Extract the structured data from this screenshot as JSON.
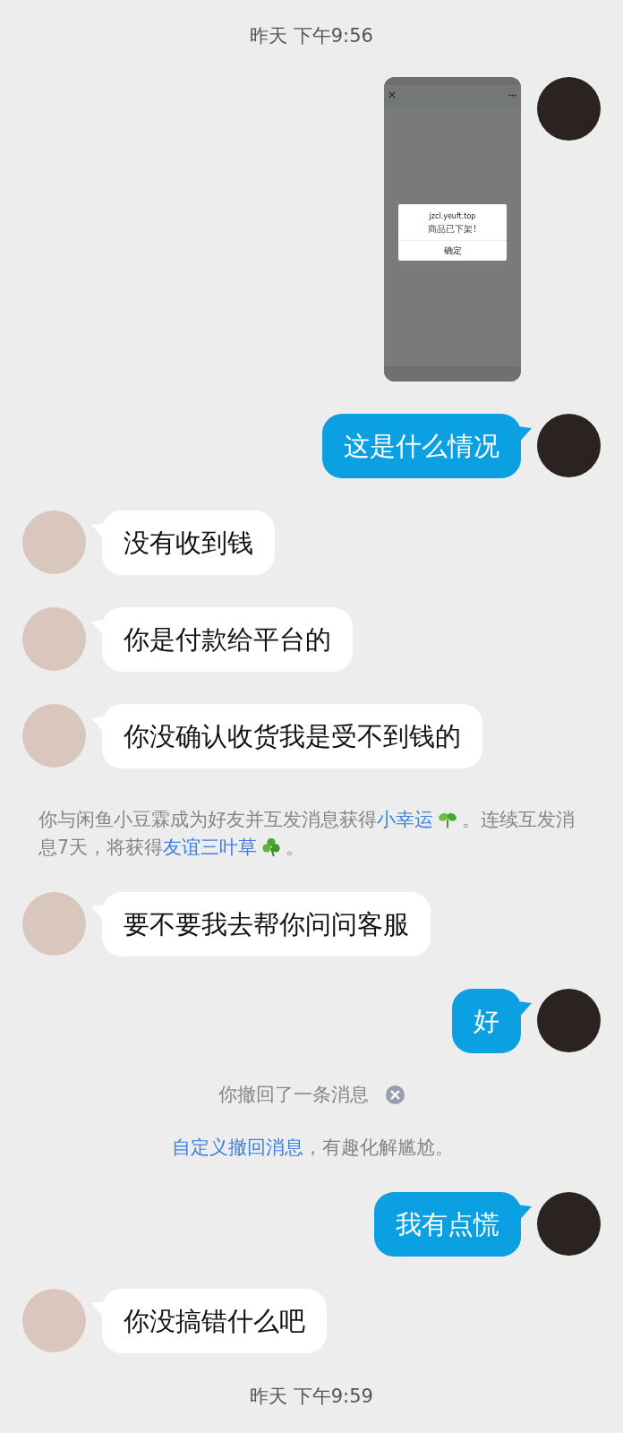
{
  "messages": [
    {
      "kind": "timestamp",
      "text": "昨天 下午9:56"
    },
    {
      "kind": "image-sent",
      "screenshot": {
        "url": "jzcl.yeuft.top",
        "message": "商品已下架!",
        "button": "确定"
      }
    },
    {
      "kind": "sent",
      "text": "这是什么情况"
    },
    {
      "kind": "received",
      "text": "没有收到钱"
    },
    {
      "kind": "received",
      "text": "你是付款给平台的"
    },
    {
      "kind": "received",
      "text": "你没确认收货我是受不到钱的"
    },
    {
      "kind": "notice",
      "parts": [
        {
          "kind": "plain",
          "text": "你与闲鱼小豆霖成为好友并互发消息获得"
        },
        {
          "kind": "link",
          "text": "小幸运"
        },
        {
          "kind": "icon"
        },
        {
          "kind": "plain",
          "text": "。连续互发消息7天，将获得"
        },
        {
          "kind": "link",
          "text": "友谊三叶草"
        },
        {
          "kind": "icon"
        },
        {
          "kind": "plain",
          "text": "。"
        }
      ]
    },
    {
      "kind": "received",
      "text": "要不要我去帮你问问客服"
    },
    {
      "kind": "sent",
      "text": "好"
    },
    {
      "kind": "recall",
      "text": "你撤回了一条消息"
    },
    {
      "kind": "notice",
      "parts": [
        {
          "kind": "link",
          "text": "自定义撤回消息"
        },
        {
          "kind": "plain",
          "text": "，有趣化解尴尬。"
        }
      ]
    },
    {
      "kind": "sent",
      "text": "我有点慌"
    },
    {
      "kind": "received",
      "text": "你没搞错什么吧"
    },
    {
      "kind": "timestamp",
      "text": "昨天 下午9:59"
    }
  ]
}
